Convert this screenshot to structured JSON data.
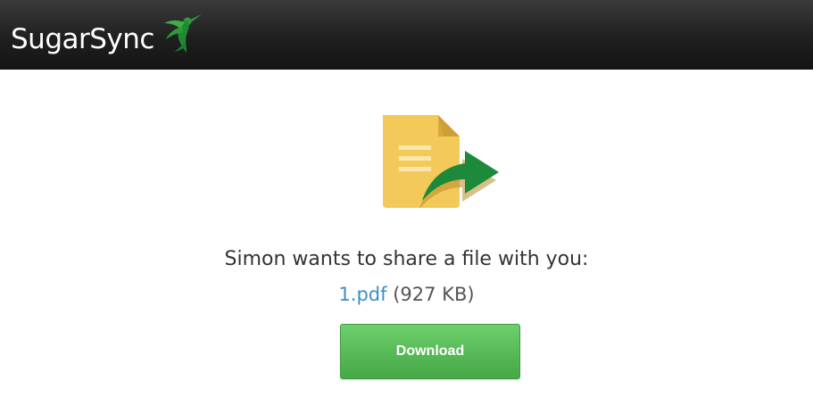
{
  "header": {
    "logo_text": "SugarSync",
    "logo_icon": "hummingbird-icon",
    "background_color": "#1a1a1a"
  },
  "main": {
    "share_icon": "file-share-icon",
    "message": "Simon wants to share a file with you:",
    "file": {
      "name": "1.pdf",
      "size": "(927 KB)"
    },
    "download_label": "Download"
  },
  "colors": {
    "link": "#3c8fc4",
    "button": "#55b955",
    "icon_arrow": "#1c8a3a",
    "icon_document": "#f3ca59"
  }
}
